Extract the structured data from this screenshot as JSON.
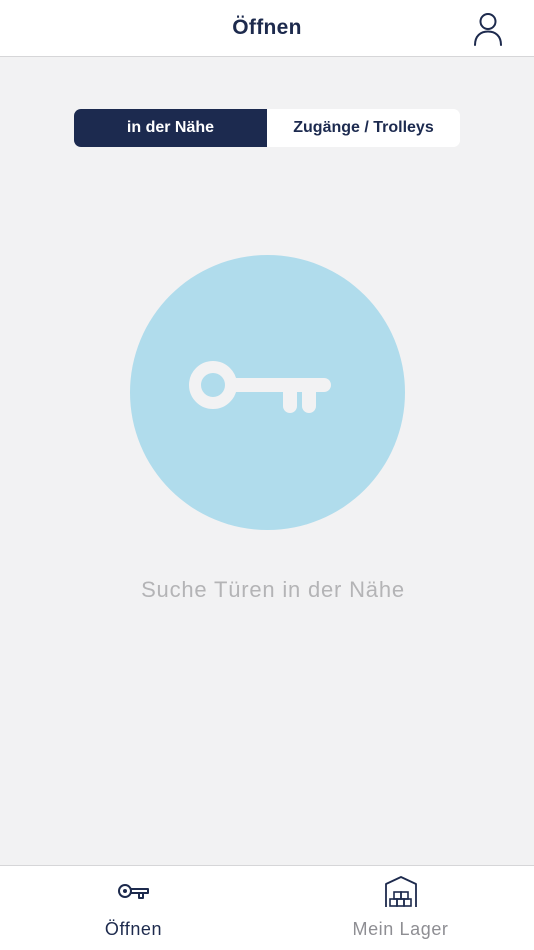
{
  "header": {
    "title": "Öffnen",
    "profile_icon": "person-outline-icon"
  },
  "segmented_control": {
    "selected": "in der Nähe",
    "options": [
      "in der Nähe",
      "Zugänge / Trolleys"
    ]
  },
  "main": {
    "center_icon": "key-icon",
    "status_text": "Suche Türen in der Nähe"
  },
  "bottom_nav": {
    "items": [
      {
        "label": "Öffnen",
        "icon": "key-icon",
        "active": true
      },
      {
        "label": "Mein Lager",
        "icon": "storage-unit-icon",
        "active": false
      }
    ]
  },
  "colors": {
    "primary": "#1c2a4f",
    "circle": "#b0dcec",
    "background": "#f2f2f3",
    "muted_text": "#b4b4b6",
    "inactive_nav": "#8e8e93"
  }
}
